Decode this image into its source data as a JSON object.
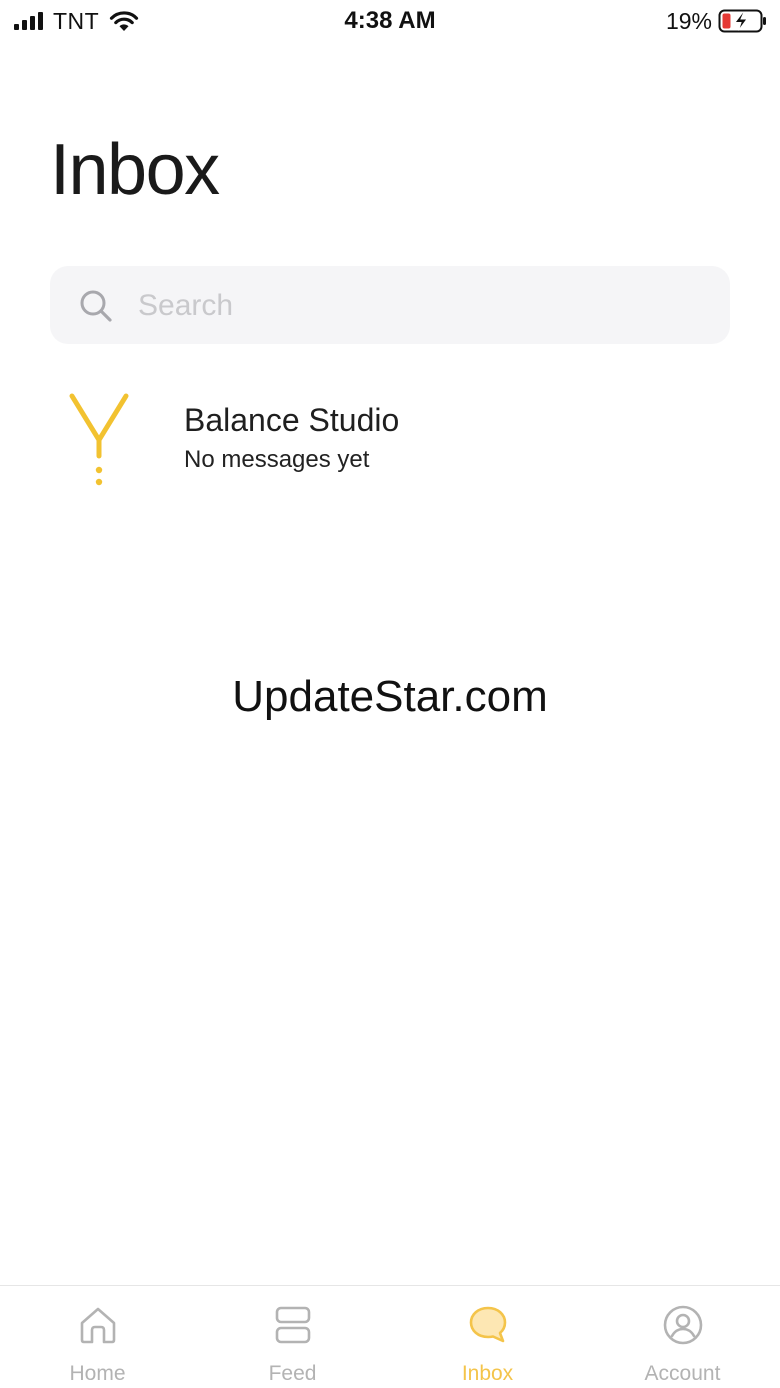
{
  "status_bar": {
    "carrier": "TNT",
    "time": "4:38 AM",
    "battery_percent": "19%",
    "signal_icon": "cellular-signal-icon",
    "wifi_icon": "wifi-icon",
    "battery_icon": "battery-charging-icon"
  },
  "page": {
    "title": "Inbox"
  },
  "search": {
    "placeholder": "Search",
    "value": "",
    "icon": "search-icon"
  },
  "conversations": [
    {
      "name": "Balance Studio",
      "preview": "No messages yet",
      "logo_icon": "balance-studio-logo",
      "logo_color": "#f2c230"
    }
  ],
  "watermark": "UpdateStar.com",
  "tabs": [
    {
      "label": "Home",
      "icon": "home-icon",
      "active": false
    },
    {
      "label": "Feed",
      "icon": "feed-icon",
      "active": false
    },
    {
      "label": "Inbox",
      "icon": "chat-bubble-icon",
      "active": true
    },
    {
      "label": "Account",
      "icon": "account-icon",
      "active": false
    }
  ],
  "colors": {
    "accent": "#f4c44a",
    "inactive": "#b3b3b3",
    "search_bg": "#f5f5f7",
    "battery_low": "#e53935"
  }
}
